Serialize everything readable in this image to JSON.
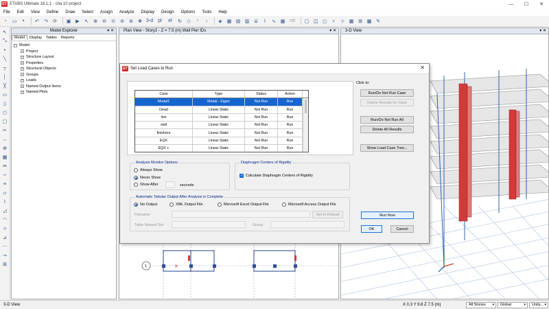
{
  "app": {
    "title": "ETABS Ultimate 18.1.1 - cha 10 project",
    "icon_label": "ET"
  },
  "menu": [
    "File",
    "Edit",
    "View",
    "Define",
    "Draw",
    "Select",
    "Assign",
    "Analyze",
    "Display",
    "Design",
    "Options",
    "Tools",
    "Help"
  ],
  "toolbar": {
    "view_3d_label": "3-d",
    "view_pl_label": "pl",
    "view_el_label": "el",
    "view_nd_label": "nd"
  },
  "explorer": {
    "title": "Model Explorer",
    "tabs": [
      "Model",
      "Display",
      "Tables",
      "Reports"
    ],
    "root": "Model",
    "items": [
      "Project",
      "Structure Layout",
      "Properties",
      "Structural Objects",
      "Groups",
      "Loads",
      "Named Output Items",
      "Named Plots"
    ]
  },
  "plan_view": {
    "title": "Plan View - Story2 - Z = 7.5 (m)  Wall Pier IDs",
    "gridline_bubble": "1"
  },
  "view_3d": {
    "title": "3-D View"
  },
  "dialog": {
    "title": "Set Load Cases to Run",
    "table": {
      "headers": [
        "Case",
        "Type",
        "Status",
        "Action"
      ],
      "rows": [
        [
          "Modal1",
          "Modal - Eigen",
          "Not Run",
          "Run"
        ],
        [
          "Dead",
          "Linear Static",
          "Not Run",
          "Run"
        ],
        [
          "live",
          "Linear Static",
          "Not Run",
          "Run"
        ],
        [
          "wall",
          "Linear Static",
          "Not Run",
          "Run"
        ],
        [
          "finishers",
          "Linear Static",
          "Not Run",
          "Run"
        ],
        [
          "EQX",
          "Linear Static",
          "Not Run",
          "Run"
        ],
        [
          "EQX +",
          "Linear Static",
          "Not Run",
          "Run"
        ]
      ],
      "selected_row": 0
    },
    "click_to": {
      "label": "Click to:",
      "run_do_not_run_case": "Run/Do Not Run Case",
      "delete_results_for_case": "Delete Results for Case",
      "run_do_not_run_all": "Run/Do Not Run All",
      "delete_all_results": "Delete All Results",
      "show_load_case_tree": "Show Load Case Tree..."
    },
    "analysis_monitor": {
      "label": "Analysis Monitor Options",
      "always_show": "Always Show",
      "never_show": "Never Show",
      "show_after": "Show After",
      "seconds": "seconds",
      "selected": "Never Show"
    },
    "diaphragm": {
      "label": "Diaphragm Centers of Rigidity",
      "calculate": "Calculate Diaphragm Centers of Rigidity",
      "checked": true
    },
    "auto_output": {
      "label": "Automatic Tabular Output After Analysis is Complete",
      "no_output": "No Output",
      "xml": "XML Output File",
      "excel": "Microsoft Excel Output File",
      "access": "Microsoft Access Output File",
      "selected": "No Output",
      "filename_label": "Filename",
      "set_to_default": "Set to Default",
      "table_named_set_label": "Table Named Set",
      "group_label": "Group"
    },
    "run_now": "Run Now",
    "ok": "OK",
    "cancel": "Cancel"
  },
  "status": {
    "left": "3-D View",
    "coords": "X 0.3  Y 9.8  Z 7.5 (m)",
    "stories": "All Stories",
    "coord_system": "Global",
    "units": "Units..."
  },
  "colors": {
    "accent": "#1565d0",
    "selection": "#1565d0",
    "wall_red": "#d23a3a",
    "frame_blue": "#1f4fae"
  }
}
